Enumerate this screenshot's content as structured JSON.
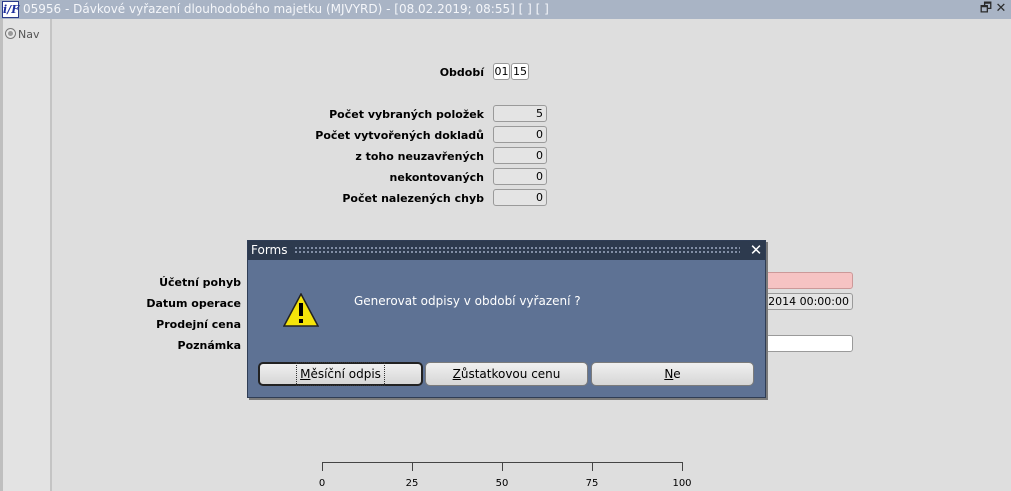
{
  "window": {
    "title": "05956 - Dávkové vyřazení dlouhodobého majetku (MJVYRD) - [08.02.2019; 08:55]  [ ]  [ ]",
    "icon": "app-logo-icon",
    "restore_glyph": "🗗",
    "close_glyph": "✕"
  },
  "nav": {
    "item_label": "Nav"
  },
  "form": {
    "obdobi_label": "Období",
    "obdobi_month": "01",
    "obdobi_year": "15",
    "counts": [
      {
        "label": "Počet vybraných položek",
        "value": "5"
      },
      {
        "label": "Počet vytvořených dokladů",
        "value": "0"
      },
      {
        "label": "z toho  neuzavřených",
        "value": "0"
      },
      {
        "label": "nekontovaných",
        "value": "0"
      },
      {
        "label": "Počet nalezených chyb",
        "value": "0"
      }
    ],
    "ucetni_pohyb_label": "Účetní pohyb",
    "ucetni_pohyb_value": "",
    "datum_operace_label": "Datum operace",
    "datum_operace_value": "0.2014 00:00:00",
    "prodejni_cena_label": "Prodejní cena",
    "poznamka_label": "Poznámka",
    "poznamka_value": ""
  },
  "progress": {
    "ticks": [
      "0",
      "25",
      "50",
      "75",
      "100"
    ],
    "value_percent": 0
  },
  "dialog": {
    "title": "Forms",
    "close_glyph": "✕",
    "icon": "warning-icon",
    "message": "Generovat odpisy v období vyřazení ?",
    "buttons": [
      {
        "pre": "",
        "mnemonic": "M",
        "post": "ěsíční odpis",
        "default": true
      },
      {
        "pre": "",
        "mnemonic": "Z",
        "post": "ůstatkovou cenu",
        "default": false
      },
      {
        "pre": "",
        "mnemonic": "N",
        "post": "e",
        "default": false
      }
    ]
  },
  "colors": {
    "titlebar": "#a9b4c5",
    "dialog_body": "#5e7294",
    "dialog_title": "#2d3a4e",
    "required_field": "#f6c3c3",
    "warning_yellow": "#f5e40a"
  }
}
